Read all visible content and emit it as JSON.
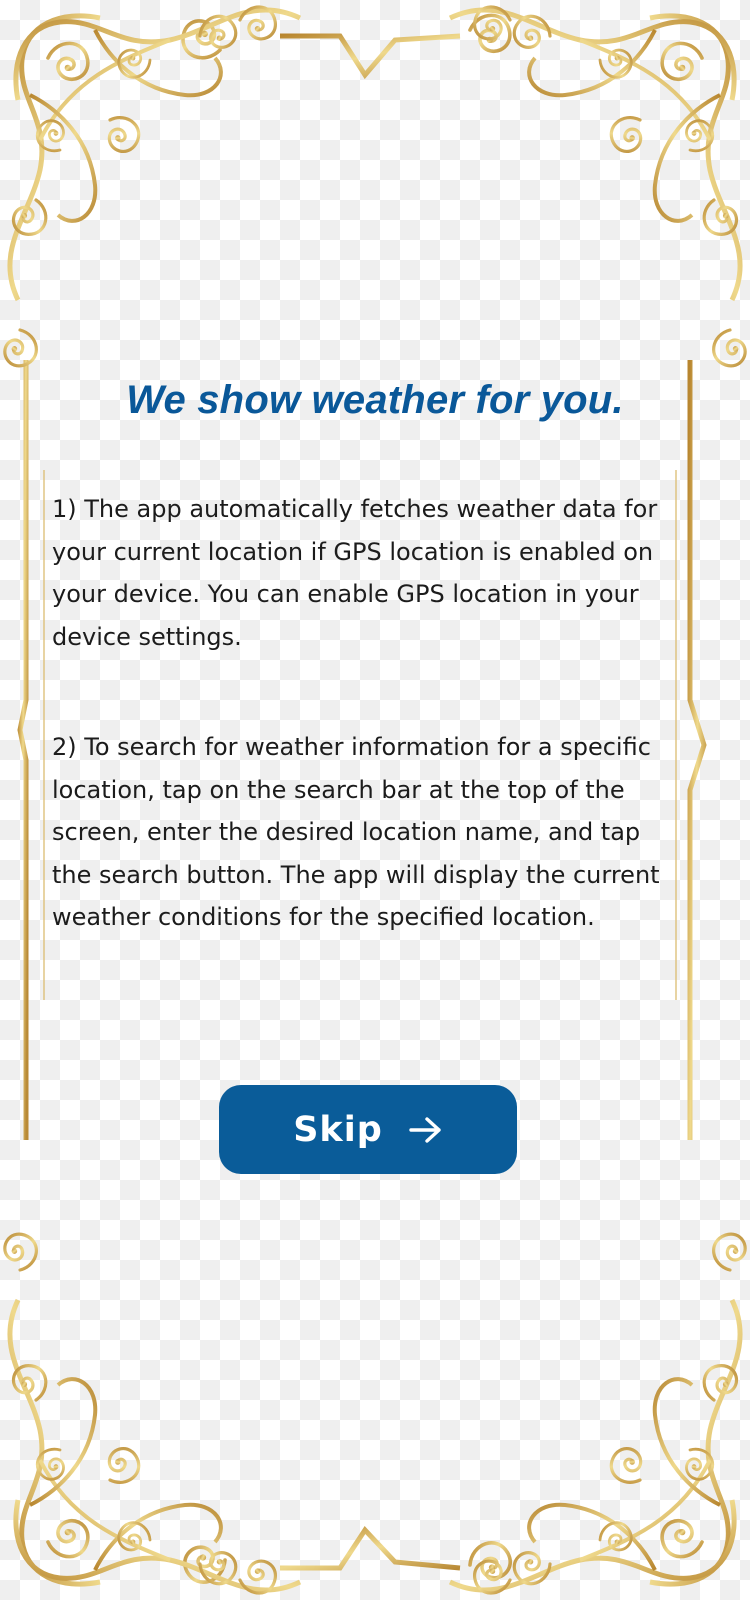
{
  "onboarding": {
    "title": "We show weather for you.",
    "paragraphs": [
      "1) The app automatically fetches weather data for your current location if GPS location is enabled on your device. You can enable GPS location in your device settings.",
      "2) To search for weather information for a specific location, tap on the search bar at the top of the screen, enter the desired location name, and tap the search button. The app will display the current weather conditions for the specified location."
    ],
    "skip_button": {
      "label": "Skip",
      "icon": "arrow-right-icon"
    }
  },
  "colors": {
    "title": "#0a5899",
    "button": "#0a5c99",
    "frame_gold": "#c9a24a",
    "frame_light": "#efd98c"
  }
}
